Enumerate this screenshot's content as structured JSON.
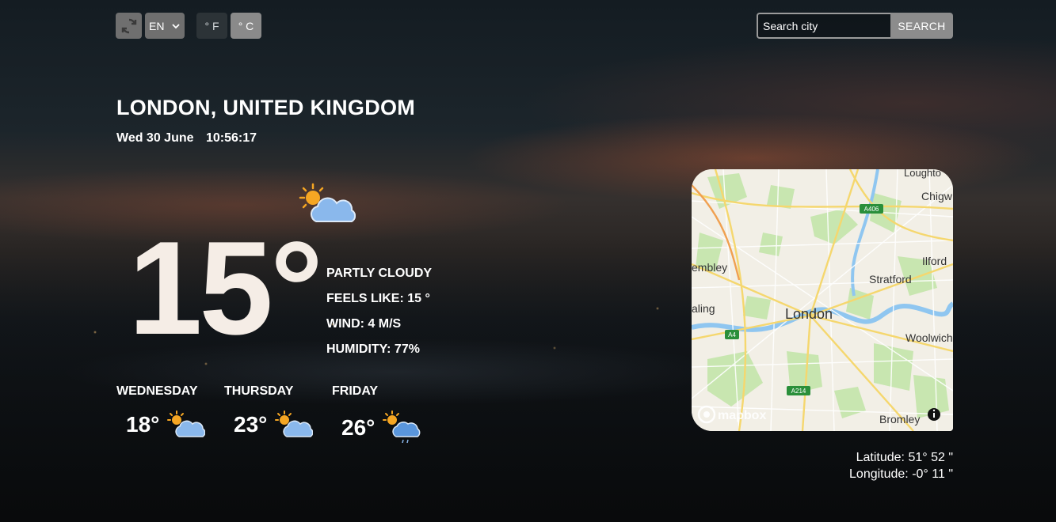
{
  "toolbar": {
    "language": "EN",
    "unit_f": "° F",
    "unit_c": "° C"
  },
  "search": {
    "placeholder": "Search city",
    "button": "SEARCH"
  },
  "location": "LONDON, UNITED KINGDOM",
  "date": "Wed 30 June",
  "time": "10:56:17",
  "current": {
    "temperature": "15°",
    "condition": "PARTLY CLOUDY",
    "feels_like": "FEELS LIKE: 15 °",
    "wind": "WIND: 4 M/S",
    "humidity": "HUMIDITY: 77%",
    "icon": "partly-cloudy-icon"
  },
  "forecast": [
    {
      "day": "WEDNESDAY",
      "temp": "18°",
      "icon": "partly-cloudy-icon"
    },
    {
      "day": "THURSDAY",
      "temp": "23°",
      "icon": "partly-cloudy-icon"
    },
    {
      "day": "FRIDAY",
      "temp": "26°",
      "icon": "sun-rain-icon"
    }
  ],
  "map": {
    "labels": {
      "london": "London",
      "stratford": "Stratford",
      "wembley": "embley",
      "ealing": "aling",
      "ilford": "Ilford",
      "woolwich": "Woolwich",
      "bromley": "Bromley",
      "chigwell": "Chigw",
      "loughton": "Loughto",
      "a406": "A406",
      "a4": "A4",
      "a214": "A214"
    },
    "attribution": "mapbox",
    "colors": {
      "park": "#c8e6b0",
      "water": "#8fc6f0",
      "road": "#f5d76e",
      "land": "#f2efe6"
    }
  },
  "coordinates": {
    "latitude": "Latitude: 51° 52 ʺ",
    "longitude": "Longitude: -0° 11 ʺ"
  }
}
